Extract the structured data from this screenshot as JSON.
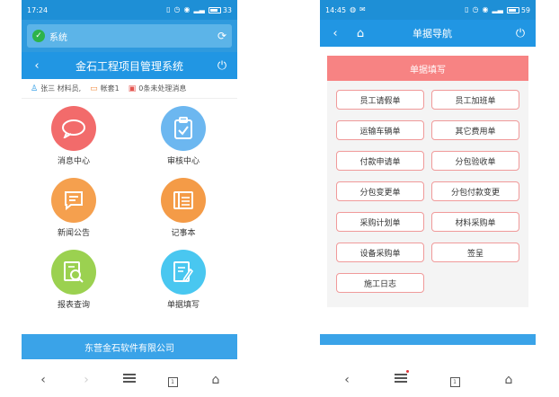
{
  "left": {
    "status": {
      "time": "17:24",
      "battery": "33"
    },
    "system_bar": {
      "label": "系统"
    },
    "title": "金石工程项目管理系统",
    "user_bar": {
      "user": "张三 材料员,",
      "account": "帐套1",
      "messages": "0条未处理消息"
    },
    "tiles": [
      {
        "label": "消息中心",
        "icon": "chat-bubble-icon"
      },
      {
        "label": "审核中心",
        "icon": "clipboard-check-icon"
      },
      {
        "label": "新闻公告",
        "icon": "message-square-icon"
      },
      {
        "label": "记事本",
        "icon": "notebook-icon"
      },
      {
        "label": "报表查询",
        "icon": "report-search-icon"
      },
      {
        "label": "单据填写",
        "icon": "edit-document-icon"
      }
    ],
    "footer": "东营金石软件有限公司"
  },
  "right": {
    "status": {
      "time": "14:45",
      "battery": "59"
    },
    "title": "单据导航",
    "form_header": "单据填写",
    "buttons": [
      "员工请假单",
      "员工加班单",
      "运输车辆单",
      "其它费用单",
      "付款申请单",
      "分包验收单",
      "分包变更单",
      "分包付款变更",
      "采购计划单",
      "材料采购单",
      "设备采购单",
      "签呈",
      "施工日志"
    ]
  },
  "colors": {
    "status_blue": "#1e8fd6",
    "title_blue": "#2196e3",
    "footer_blue": "#3aa3e8",
    "form_header_pink": "#f78383",
    "button_border": "#f09a9a"
  }
}
